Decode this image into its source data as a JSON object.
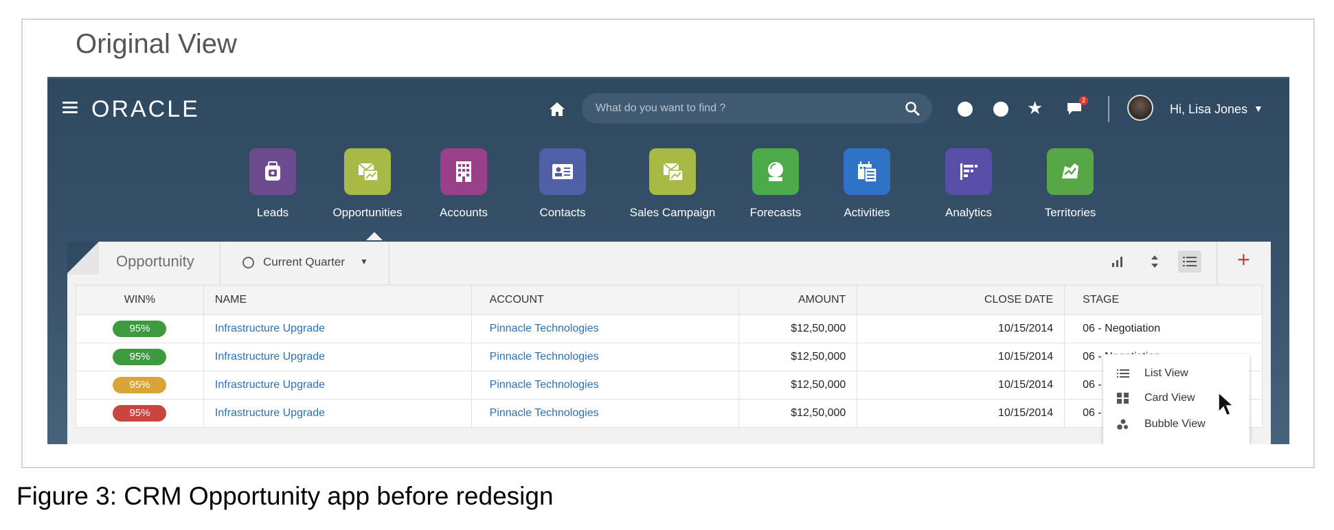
{
  "figure": {
    "frame_title": "Original View",
    "caption": "Figure 3: CRM Opportunity app before redesign"
  },
  "header": {
    "logo": "ORACLE",
    "search_placeholder": "What do you want to find ?",
    "notification_count": "2",
    "user_greeting": "Hi, Lisa Jones"
  },
  "nav": {
    "items": [
      {
        "label": "Leads",
        "color": "#6d4b8e"
      },
      {
        "label": "Opportunities",
        "color": "#a8b945"
      },
      {
        "label": "Accounts",
        "color": "#9a3f8a"
      },
      {
        "label": "Contacts",
        "color": "#5060a7"
      },
      {
        "label": "Sales Campaign",
        "color": "#a8b945"
      },
      {
        "label": "Forecasts",
        "color": "#4caa4b"
      },
      {
        "label": "Activities",
        "color": "#2e73c6"
      },
      {
        "label": "Analytics",
        "color": "#5a4fa8"
      },
      {
        "label": "Territories",
        "color": "#58a746"
      }
    ],
    "selected": "Opportunities"
  },
  "panel": {
    "title": "Opportunity",
    "period": "Current Quarter"
  },
  "table": {
    "columns": [
      "WIN%",
      "NAME",
      "ACCOUNT",
      "AMOUNT",
      "CLOSE DATE",
      "STAGE"
    ],
    "rows": [
      {
        "win": "95%",
        "win_color": "#3e9a3e",
        "name": "Infrastructure Upgrade",
        "account": "Pinnacle Technologies",
        "amount": "$12,50,000",
        "close_date": "10/15/2014",
        "stage": "06 - Negotiation"
      },
      {
        "win": "95%",
        "win_color": "#3e9a3e",
        "name": "Infrastructure Upgrade",
        "account": "Pinnacle Technologies",
        "amount": "$12,50,000",
        "close_date": "10/15/2014",
        "stage": "06 - Negotiation"
      },
      {
        "win": "95%",
        "win_color": "#d8a536",
        "name": "Infrastructure Upgrade",
        "account": "Pinnacle Technologies",
        "amount": "$12,50,000",
        "close_date": "10/15/2014",
        "stage": "06 - Negotiation"
      },
      {
        "win": "95%",
        "win_color": "#c9453f",
        "name": "Infrastructure Upgrade",
        "account": "Pinnacle Technologies",
        "amount": "$12,50,000",
        "close_date": "10/15/2014",
        "stage": "06 - Negotiation"
      }
    ]
  },
  "view_menu": {
    "items": [
      {
        "label": "List View",
        "icon": "list-icon"
      },
      {
        "label": "Card View",
        "icon": "grid-icon"
      },
      {
        "label": "Bubble View",
        "icon": "bubble-icon"
      }
    ]
  },
  "colors": {
    "header_bg": "#2e4960",
    "accent_add": "#d63b2f",
    "link": "#2e6fb3"
  }
}
